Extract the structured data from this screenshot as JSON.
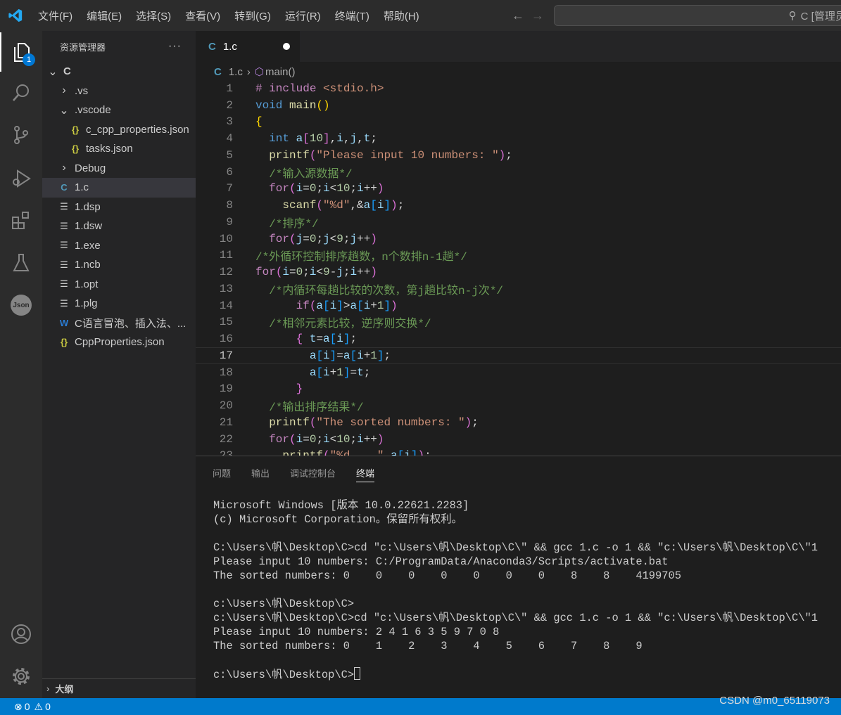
{
  "titlebar": {
    "menu": [
      "文件(F)",
      "编辑(E)",
      "选择(S)",
      "查看(V)",
      "转到(G)",
      "运行(R)",
      "终端(T)",
      "帮助(H)"
    ],
    "search_text": "C [管理员]"
  },
  "activity": {
    "explorer_badge": "1"
  },
  "sidebar": {
    "title": "资源管理器",
    "more": "···",
    "tree": [
      {
        "label": "C",
        "indent": 0,
        "icon": "chevron-down",
        "bold": true
      },
      {
        "label": ".vs",
        "indent": 1,
        "icon": "chevron-right"
      },
      {
        "label": ".vscode",
        "indent": 1,
        "icon": "chevron-down"
      },
      {
        "label": "c_cpp_properties.json",
        "indent": 2,
        "icon": "json"
      },
      {
        "label": "tasks.json",
        "indent": 2,
        "icon": "json"
      },
      {
        "label": "Debug",
        "indent": 1,
        "icon": "chevron-right"
      },
      {
        "label": "1.c",
        "indent": 1,
        "icon": "c",
        "selected": true
      },
      {
        "label": "1.dsp",
        "indent": 1,
        "icon": "file"
      },
      {
        "label": "1.dsw",
        "indent": 1,
        "icon": "file"
      },
      {
        "label": "1.exe",
        "indent": 1,
        "icon": "file"
      },
      {
        "label": "1.ncb",
        "indent": 1,
        "icon": "file"
      },
      {
        "label": "1.opt",
        "indent": 1,
        "icon": "file"
      },
      {
        "label": "1.plg",
        "indent": 1,
        "icon": "file"
      },
      {
        "label": "C语言冒泡、插入法、...",
        "indent": 1,
        "icon": "word"
      },
      {
        "label": "CppProperties.json",
        "indent": 1,
        "icon": "json"
      }
    ],
    "outline": "大纲"
  },
  "tabs": [
    {
      "label": "1.c",
      "icon": "C",
      "modified": true
    }
  ],
  "breadcrumb": {
    "file": "1.c",
    "symbol": "main()"
  },
  "editor": {
    "current_line": 17,
    "lines": [
      [
        [
          "inc",
          "# include "
        ],
        [
          "str",
          "<stdio.h>"
        ]
      ],
      [
        [
          "kw",
          "void"
        ],
        [
          "pl",
          " "
        ],
        [
          "fn",
          "main"
        ],
        [
          "b1",
          "()"
        ]
      ],
      [
        [
          "b1",
          "{"
        ]
      ],
      [
        [
          "pl",
          "  "
        ],
        [
          "kw",
          "int"
        ],
        [
          "pl",
          " "
        ],
        [
          "var",
          "a"
        ],
        [
          "b2",
          "["
        ],
        [
          "num",
          "10"
        ],
        [
          "b2",
          "]"
        ],
        [
          "pl",
          ","
        ],
        [
          "var",
          "i"
        ],
        [
          "pl",
          ","
        ],
        [
          "var",
          "j"
        ],
        [
          "pl",
          ","
        ],
        [
          "var",
          "t"
        ],
        [
          "pl",
          ";"
        ]
      ],
      [
        [
          "pl",
          "  "
        ],
        [
          "fn",
          "printf"
        ],
        [
          "b2",
          "("
        ],
        [
          "str",
          "\"Please input 10 numbers: \""
        ],
        [
          "b2",
          ")"
        ],
        [
          "pl",
          ";"
        ]
      ],
      [
        [
          "pl",
          "  "
        ],
        [
          "cm",
          "/*输入源数据*/"
        ]
      ],
      [
        [
          "pl",
          "  "
        ],
        [
          "ctl",
          "for"
        ],
        [
          "b2",
          "("
        ],
        [
          "var",
          "i"
        ],
        [
          "pl",
          "="
        ],
        [
          "num",
          "0"
        ],
        [
          "pl",
          ";"
        ],
        [
          "var",
          "i"
        ],
        [
          "pl",
          "<"
        ],
        [
          "num",
          "10"
        ],
        [
          "pl",
          ";"
        ],
        [
          "var",
          "i"
        ],
        [
          "pl",
          "++"
        ],
        [
          "b2",
          ")"
        ]
      ],
      [
        [
          "pl",
          "    "
        ],
        [
          "fn",
          "scanf"
        ],
        [
          "b2",
          "("
        ],
        [
          "str",
          "\"%d\""
        ],
        [
          "pl",
          ",&"
        ],
        [
          "var",
          "a"
        ],
        [
          "b3",
          "["
        ],
        [
          "var",
          "i"
        ],
        [
          "b3",
          "]"
        ],
        [
          "b2",
          ")"
        ],
        [
          "pl",
          ";"
        ]
      ],
      [
        [
          "pl",
          "  "
        ],
        [
          "cm",
          "/*排序*/"
        ]
      ],
      [
        [
          "pl",
          "  "
        ],
        [
          "ctl",
          "for"
        ],
        [
          "b2",
          "("
        ],
        [
          "var",
          "j"
        ],
        [
          "pl",
          "="
        ],
        [
          "num",
          "0"
        ],
        [
          "pl",
          ";"
        ],
        [
          "var",
          "j"
        ],
        [
          "pl",
          "<"
        ],
        [
          "num",
          "9"
        ],
        [
          "pl",
          ";"
        ],
        [
          "var",
          "j"
        ],
        [
          "pl",
          "++"
        ],
        [
          "b2",
          ")"
        ]
      ],
      [
        [
          "cm",
          "/*外循环控制排序趟数，n个数排n-1趟*/"
        ]
      ],
      [
        [
          "ctl",
          "for"
        ],
        [
          "b2",
          "("
        ],
        [
          "var",
          "i"
        ],
        [
          "pl",
          "="
        ],
        [
          "num",
          "0"
        ],
        [
          "pl",
          ";"
        ],
        [
          "var",
          "i"
        ],
        [
          "pl",
          "<"
        ],
        [
          "num",
          "9"
        ],
        [
          "pl",
          "-"
        ],
        [
          "var",
          "j"
        ],
        [
          "pl",
          ";"
        ],
        [
          "var",
          "i"
        ],
        [
          "pl",
          "++"
        ],
        [
          "b2",
          ")"
        ]
      ],
      [
        [
          "pl",
          "  "
        ],
        [
          "cm",
          "/*内循环每趟比较的次数，第j趟比较n-j次*/"
        ]
      ],
      [
        [
          "pl",
          "      "
        ],
        [
          "ctl",
          "if"
        ],
        [
          "b2",
          "("
        ],
        [
          "var",
          "a"
        ],
        [
          "b3",
          "["
        ],
        [
          "var",
          "i"
        ],
        [
          "b3",
          "]"
        ],
        [
          "pl",
          ">"
        ],
        [
          "var",
          "a"
        ],
        [
          "b3",
          "["
        ],
        [
          "var",
          "i"
        ],
        [
          "pl",
          "+"
        ],
        [
          "num",
          "1"
        ],
        [
          "b3",
          "]"
        ],
        [
          "b2",
          ")"
        ]
      ],
      [
        [
          "pl",
          "  "
        ],
        [
          "cm",
          "/*相邻元素比较，逆序则交换*/"
        ]
      ],
      [
        [
          "pl",
          "      "
        ],
        [
          "b2",
          "{"
        ],
        [
          "pl",
          " "
        ],
        [
          "var",
          "t"
        ],
        [
          "pl",
          "="
        ],
        [
          "var",
          "a"
        ],
        [
          "b3",
          "["
        ],
        [
          "var",
          "i"
        ],
        [
          "b3",
          "]"
        ],
        [
          "pl",
          ";"
        ]
      ],
      [
        [
          "pl",
          "        "
        ],
        [
          "var",
          "a"
        ],
        [
          "b3",
          "["
        ],
        [
          "var",
          "i"
        ],
        [
          "b3",
          "]"
        ],
        [
          "pl",
          "="
        ],
        [
          "var",
          "a"
        ],
        [
          "b3",
          "["
        ],
        [
          "var",
          "i"
        ],
        [
          "pl",
          "+"
        ],
        [
          "num",
          "1"
        ],
        [
          "b3",
          "]"
        ],
        [
          "pl",
          ";"
        ]
      ],
      [
        [
          "pl",
          "        "
        ],
        [
          "var",
          "a"
        ],
        [
          "b3",
          "["
        ],
        [
          "var",
          "i"
        ],
        [
          "pl",
          "+"
        ],
        [
          "num",
          "1"
        ],
        [
          "b3",
          "]"
        ],
        [
          "pl",
          "="
        ],
        [
          "var",
          "t"
        ],
        [
          "pl",
          ";"
        ]
      ],
      [
        [
          "pl",
          "      "
        ],
        [
          "b2",
          "}"
        ]
      ],
      [
        [
          "pl",
          "  "
        ],
        [
          "cm",
          "/*输出排序结果*/"
        ]
      ],
      [
        [
          "pl",
          "  "
        ],
        [
          "fn",
          "printf"
        ],
        [
          "b2",
          "("
        ],
        [
          "str",
          "\"The sorted numbers: \""
        ],
        [
          "b2",
          ")"
        ],
        [
          "pl",
          ";"
        ]
      ],
      [
        [
          "pl",
          "  "
        ],
        [
          "ctl",
          "for"
        ],
        [
          "b2",
          "("
        ],
        [
          "var",
          "i"
        ],
        [
          "pl",
          "="
        ],
        [
          "num",
          "0"
        ],
        [
          "pl",
          ";"
        ],
        [
          "var",
          "i"
        ],
        [
          "pl",
          "<"
        ],
        [
          "num",
          "10"
        ],
        [
          "pl",
          ";"
        ],
        [
          "var",
          "i"
        ],
        [
          "pl",
          "++"
        ],
        [
          "b2",
          ")"
        ]
      ],
      [
        [
          "pl",
          "    "
        ],
        [
          "fn",
          "printf"
        ],
        [
          "b2",
          "("
        ],
        [
          "str",
          "\"%d    \""
        ],
        [
          "pl",
          ","
        ],
        [
          "var",
          "a"
        ],
        [
          "b3",
          "["
        ],
        [
          "var",
          "i"
        ],
        [
          "b3",
          "]"
        ],
        [
          "b2",
          ")"
        ],
        [
          "pl",
          ";"
        ]
      ]
    ]
  },
  "panel": {
    "tabs": [
      "问题",
      "输出",
      "调试控制台",
      "终端"
    ],
    "active_tab": "终端",
    "terminal": [
      "Microsoft Windows [版本 10.0.22621.2283]",
      "(c) Microsoft Corporation。保留所有权利。",
      "",
      "C:\\Users\\帆\\Desktop\\C>cd \"c:\\Users\\帆\\Desktop\\C\\\" && gcc 1.c -o 1 && \"c:\\Users\\帆\\Desktop\\C\\\"1",
      "Please input 10 numbers: C:/ProgramData/Anaconda3/Scripts/activate.bat",
      "The sorted numbers: 0    0    0    0    0    0    0    8    8    4199705",
      "",
      "c:\\Users\\帆\\Desktop\\C>",
      "c:\\Users\\帆\\Desktop\\C>cd \"c:\\Users\\帆\\Desktop\\C\\\" && gcc 1.c -o 1 && \"c:\\Users\\帆\\Desktop\\C\\\"1",
      "Please input 10 numbers: 2 4 1 6 3 5 9 7 0 8",
      "The sorted numbers: 0    1    2    3    4    5    6    7    8    9",
      "",
      "c:\\Users\\帆\\Desktop\\C>"
    ]
  },
  "status": {
    "errors": "0",
    "warnings": "0",
    "watermark": "CSDN @m0_65119073"
  },
  "colors": {
    "accent": "#007acc",
    "badge": "#0078d4"
  }
}
